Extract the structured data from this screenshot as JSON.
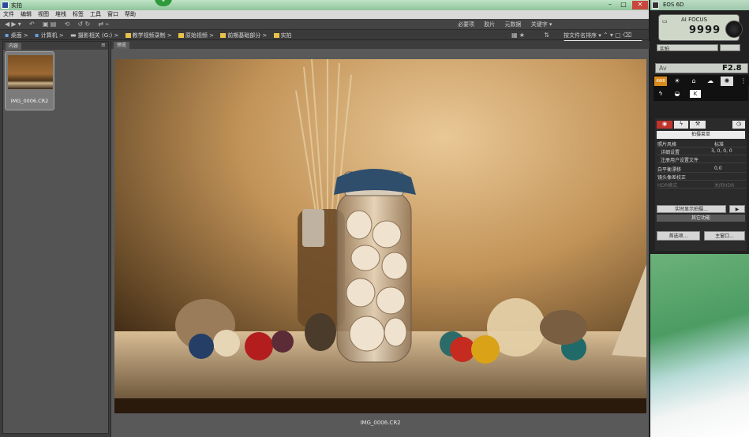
{
  "bridge": {
    "window_title": "实拍",
    "menu": [
      "文件",
      "编辑",
      "视图",
      "堆栈",
      "标签",
      "工具",
      "窗口",
      "帮助"
    ],
    "workspace_tabs": [
      "必要项",
      "胶片",
      "元数据",
      "关键字 ▾"
    ],
    "search_placeholder": "ρ▾",
    "breadcrumbs": [
      "桌面",
      "计算机",
      "摄影相关 (G:)",
      "教学视频录制",
      "原始视频",
      "前期基础部分",
      "实拍"
    ],
    "sort_label": "按文件名排序 ▾",
    "left_panel_tab": "内容",
    "preview_tab": "预览",
    "thumbnail_name": "IMG_0006.CR2",
    "preview_caption": "IMG_0006.CR2"
  },
  "eos": {
    "title": "EOS 6D",
    "lcd_mode": "AI FOCUS",
    "lcd_shots": "9999",
    "lcd_mode_label": "实拍",
    "av_label": "Av",
    "aperture": "F2.8",
    "white_balance_icons": [
      "awb-icon",
      "sun-icon",
      "shade-icon",
      "cloud-icon",
      "tungsten-icon",
      "fluorescent-icon",
      "flash-icon",
      "custom-wb-icon",
      "kelvin-icon"
    ],
    "kelvin_label": "K",
    "awb_label": "AWB",
    "menu_title": "拍摄菜单",
    "rows": [
      {
        "label": "照片风格",
        "value": "标准"
      },
      {
        "label": "详细设置",
        "value": "3, 0, 0, 0"
      },
      {
        "label": "注册用户设置文件",
        "value": ""
      },
      {
        "label": "白平衡漂移",
        "value": "0,0"
      },
      {
        "label": "镜头像差校正",
        "value": ""
      },
      {
        "label": "HDR模式",
        "value": "关闭HDR"
      }
    ],
    "live_view_button": "实时显示拍摄...",
    "other_functions": "其它功能",
    "preferences_button": "首选项...",
    "main_window_button": "主窗口..."
  }
}
